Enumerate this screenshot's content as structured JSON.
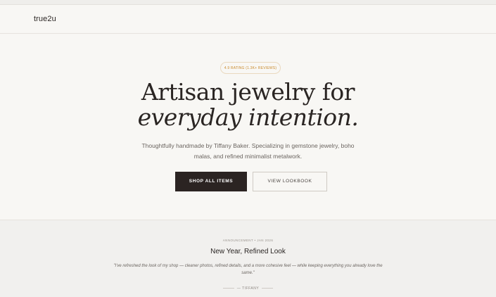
{
  "nav": {
    "logo": "true2u"
  },
  "hero": {
    "rating": "4.9 RATING (1.3K+ REVIEWS)",
    "headline_line1": "Artisan jewelry for",
    "headline_line2": "everyday intention.",
    "subtitle": "Thoughtfully handmade by Tiffany Baker. Specializing in gemstone jewelry, boho malas, and refined minimalist metalwork.",
    "primary_button": "SHOP ALL ITEMS",
    "secondary_button": "VIEW LOOKBOOK"
  },
  "announcement": {
    "label": "ANNOUNCEMENT • JAN 2026",
    "title": "New Year, Refined Look",
    "quote": "\"I've refreshed the look of my shop — cleaner photos, refined details, and a more cohesive feel — while keeping everything you already love the same.\"",
    "signature": "— TIFFANY"
  },
  "colors": {
    "background": "#f8f7f4",
    "accent": "#c98a2c",
    "dark": "#2b2422",
    "announcement_bg": "#f1f0ee"
  }
}
